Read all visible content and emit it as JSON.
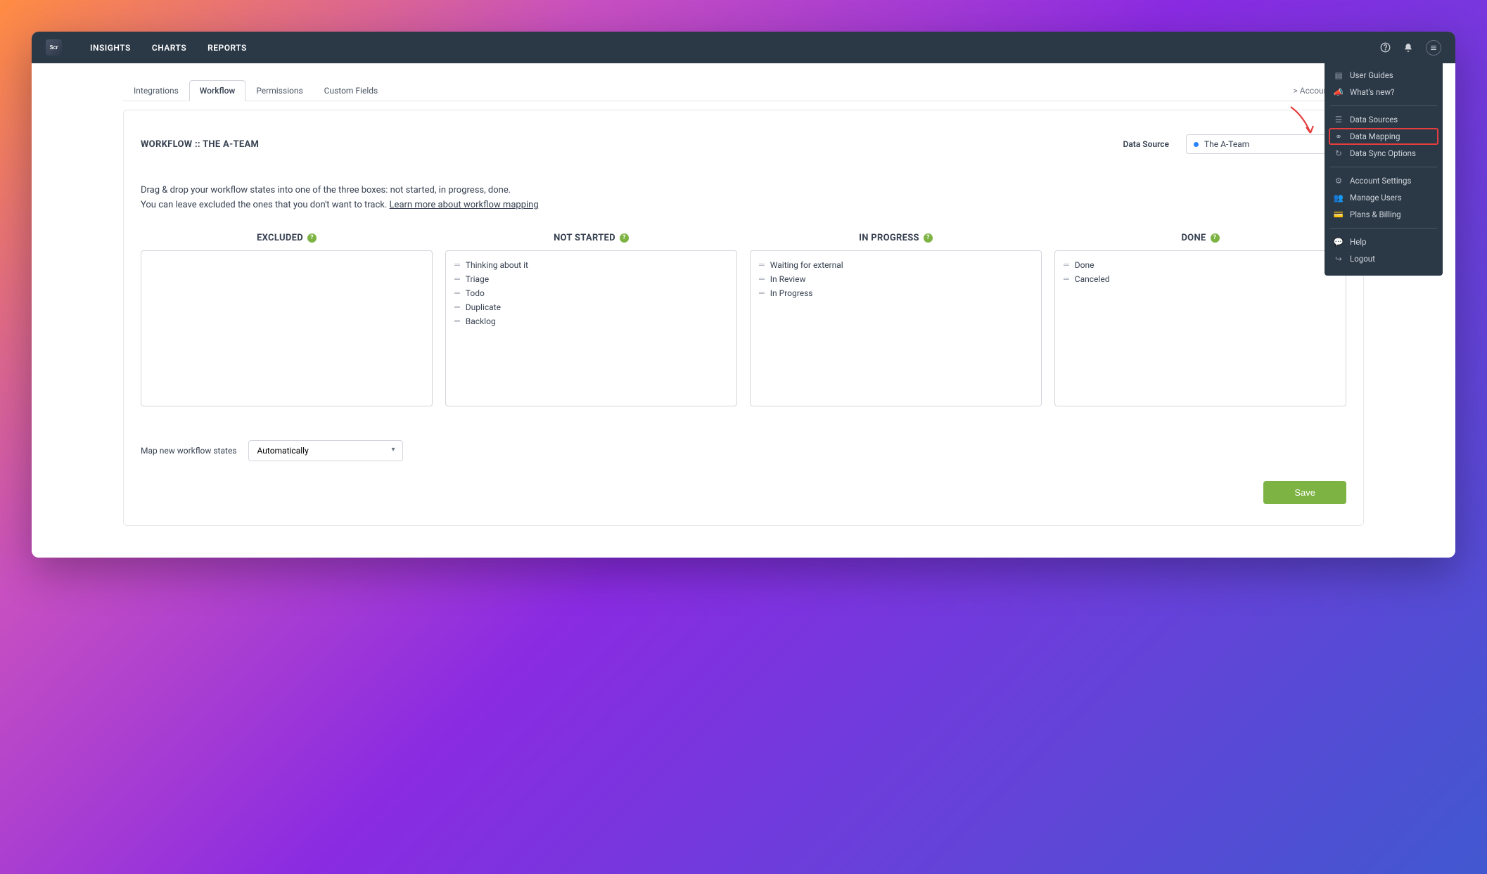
{
  "logo": "Scr",
  "nav": {
    "insights": "INSIGHTS",
    "charts": "CHARTS",
    "reports": "REPORTS"
  },
  "tabs": {
    "integrations": "Integrations",
    "workflow": "Workflow",
    "permissions": "Permissions",
    "custom_fields": "Custom Fields"
  },
  "breadcrumb": "> Account Settings",
  "panel_title": "WORKFLOW :: THE A-TEAM",
  "data_source_label": "Data Source",
  "data_source_value": "The A-Team",
  "help_line1": "Drag & drop your workflow states into one of the three boxes: not started, in progress, done.",
  "help_line2_a": "You can leave excluded the ones that you don't want to track. ",
  "help_link": "Learn more about workflow mapping",
  "columns": {
    "excluded": {
      "title": "EXCLUDED",
      "items": []
    },
    "not_started": {
      "title": "NOT STARTED",
      "items": [
        "Thinking about it",
        "Triage",
        "Todo",
        "Duplicate",
        "Backlog"
      ]
    },
    "in_progress": {
      "title": "IN PROGRESS",
      "items": [
        "Waiting for external",
        "In Review",
        "In Progress"
      ]
    },
    "done": {
      "title": "DONE",
      "items": [
        "Done",
        "Canceled"
      ]
    }
  },
  "map_label": "Map new workflow states",
  "map_value": "Automatically",
  "save_label": "Save",
  "menu": {
    "user_guides": "User Guides",
    "whats_new": "What's new?",
    "data_sources": "Data Sources",
    "data_mapping": "Data Mapping",
    "data_sync": "Data Sync Options",
    "account_settings": "Account Settings",
    "manage_users": "Manage Users",
    "plans_billing": "Plans & Billing",
    "help": "Help",
    "logout": "Logout"
  }
}
